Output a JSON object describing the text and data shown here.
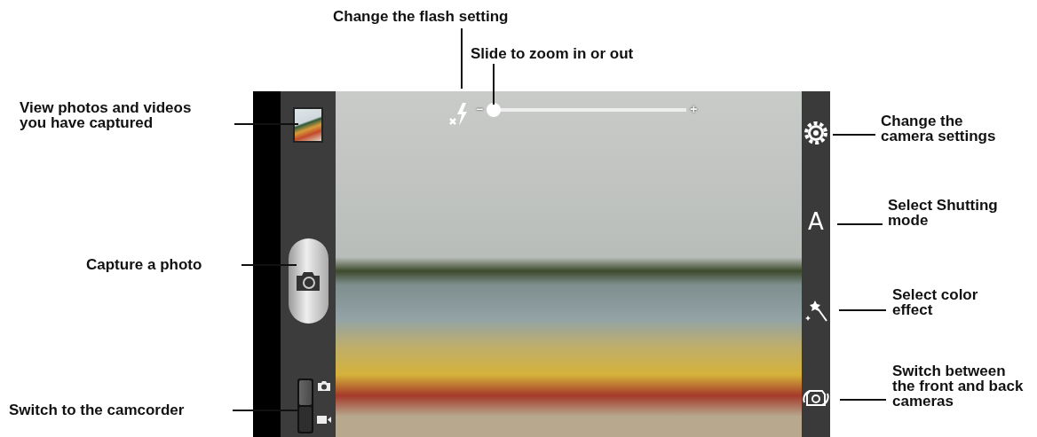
{
  "callouts": [
    {
      "text": "Change the flash setting"
    },
    {
      "text": "Slide to zoom in or out"
    },
    {
      "text": "View photos and videos you have captured"
    },
    {
      "text": "Capture a photo"
    },
    {
      "text": "Switch to the camcorder"
    },
    {
      "text": "Change the camera settings"
    },
    {
      "text": "Select Shutting mode"
    },
    {
      "text": "Select color effect"
    },
    {
      "text": "Switch between the front and back cameras"
    }
  ],
  "zoom": {
    "minus": "−",
    "plus": "+",
    "level": 0
  },
  "mode_switch": {
    "options": [
      {
        "kind": "photo",
        "selected": true
      },
      {
        "kind": "video",
        "selected": false
      }
    ]
  },
  "shooting_mode": {
    "label": "A"
  }
}
